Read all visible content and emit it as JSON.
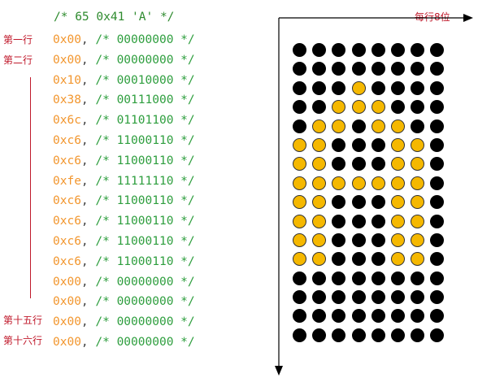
{
  "header_comment": "/* 65 0x41 'A' */",
  "per_row_label": "每行8位",
  "row_labels": {
    "first": "第一行",
    "second": "第二行",
    "fifteenth": "第十五行",
    "sixteenth": "第十六行"
  },
  "rows": [
    {
      "hex": "0x00",
      "sep": ", ",
      "comment": "/* 00000000 */",
      "bits": "00000000"
    },
    {
      "hex": "0x00",
      "sep": ", ",
      "comment": "/* 00000000 */",
      "bits": "00000000"
    },
    {
      "hex": "0x10",
      "sep": ", ",
      "comment": "/* 00010000 */",
      "bits": "00010000"
    },
    {
      "hex": "0x38",
      "sep": ", ",
      "comment": "/* 00111000 */",
      "bits": "00111000"
    },
    {
      "hex": "0x6c",
      "sep": ", ",
      "comment": "/* 01101100 */",
      "bits": "01101100"
    },
    {
      "hex": "0xc6",
      "sep": ", ",
      "comment": "/* 11000110 */",
      "bits": "11000110"
    },
    {
      "hex": "0xc6",
      "sep": ", ",
      "comment": "/* 11000110 */",
      "bits": "11000110"
    },
    {
      "hex": "0xfe",
      "sep": ", ",
      "comment": "/* 11111110 */",
      "bits": "11111110"
    },
    {
      "hex": "0xc6",
      "sep": ", ",
      "comment": "/* 11000110 */",
      "bits": "11000110"
    },
    {
      "hex": "0xc6",
      "sep": ", ",
      "comment": "/* 11000110 */",
      "bits": "11000110"
    },
    {
      "hex": "0xc6",
      "sep": ", ",
      "comment": "/* 11000110 */",
      "bits": "11000110"
    },
    {
      "hex": "0xc6",
      "sep": ", ",
      "comment": "/* 11000110 */",
      "bits": "11000110"
    },
    {
      "hex": "0x00",
      "sep": ", ",
      "comment": "/* 00000000 */",
      "bits": "00000000"
    },
    {
      "hex": "0x00",
      "sep": ", ",
      "comment": "/* 00000000 */",
      "bits": "00000000"
    },
    {
      "hex": "0x00",
      "sep": ", ",
      "comment": "/* 00000000 */",
      "bits": "00000000"
    },
    {
      "hex": "0x00",
      "sep": ", ",
      "comment": "/* 00000000 */",
      "bits": "00000000"
    }
  ],
  "colors": {
    "on_dot": "#f5b800",
    "off_dot": "#000000",
    "hex_text": "#f2962e",
    "comment_text": "#2e9e3e",
    "label_text": "#c0192b"
  }
}
